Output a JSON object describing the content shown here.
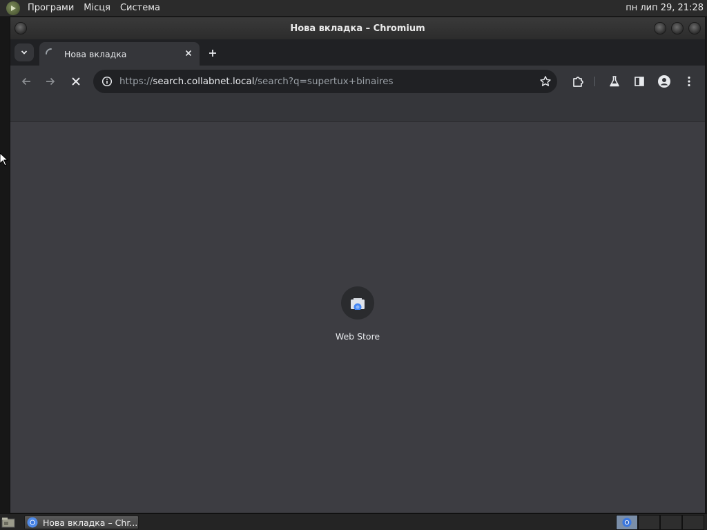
{
  "top_panel": {
    "menus": [
      "Програми",
      "Місця",
      "Система"
    ],
    "clock": "пн лип 29, 21:28"
  },
  "window": {
    "title": "Нова вкладка – Chromium"
  },
  "tabs": [
    {
      "title": "Нова вкладка",
      "loading": true
    }
  ],
  "address_bar": {
    "scheme": "https://",
    "host": "search.collabnet.local",
    "path": "/search?q=supertux+binaires"
  },
  "new_tab_page": {
    "shortcuts": [
      {
        "label": "Web Store",
        "icon": "webstore-icon"
      }
    ]
  },
  "taskbar": {
    "window_button_label": "Нова вкладка – Chr..."
  },
  "colors": {
    "accent": "#8ab4f8",
    "content_bg": "#3d3d42",
    "toolbar_bg": "#35363a"
  }
}
